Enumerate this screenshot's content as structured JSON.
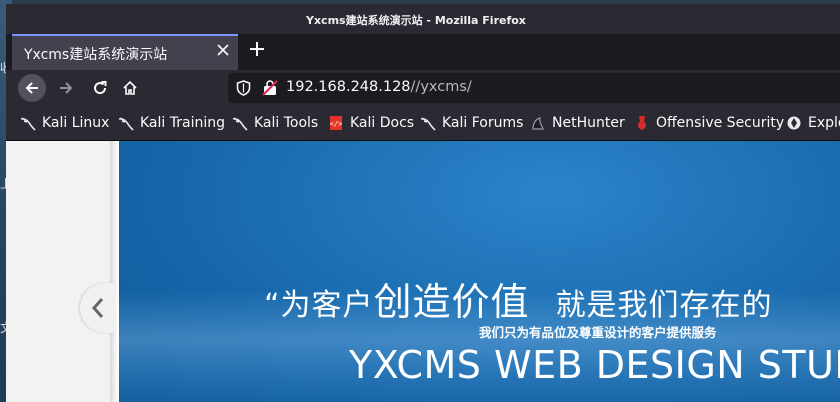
{
  "window": {
    "title": "Yxcms建站系统演示站 - Mozilla Firefox"
  },
  "desktop": {
    "fragments": [
      "收",
      "上",
      "文"
    ]
  },
  "tabs": [
    {
      "title": "Yxcms建站系统演示站",
      "close_icon": "close-icon"
    }
  ],
  "toolbar": {
    "new_tab_icon": "plus-icon",
    "back_icon": "arrow-left-icon",
    "forward_icon": "arrow-right-icon",
    "reload_icon": "reload-icon",
    "home_icon": "home-icon"
  },
  "urlbar": {
    "host": "192.168.248.128",
    "path": "//yxcms/",
    "shield_icon": "shield-icon",
    "insecure_icon": "insecure-lock-icon"
  },
  "bookmarks": [
    {
      "label": "Kali Linux",
      "icon": "kali-dragon-icon"
    },
    {
      "label": "Kali Training",
      "icon": "kali-dragon-icon"
    },
    {
      "label": "Kali Tools",
      "icon": "kali-dragon-icon"
    },
    {
      "label": "Kali Docs",
      "icon": "kali-docs-icon"
    },
    {
      "label": "Kali Forums",
      "icon": "kali-dragon-icon"
    },
    {
      "label": "NetHunter",
      "icon": "nethunter-icon"
    },
    {
      "label": "Offensive Security",
      "icon": "offsec-icon"
    },
    {
      "label": "Explo",
      "icon": "exploit-db-icon"
    }
  ],
  "page": {
    "slogan_open": "“为客户",
    "slogan_mid": "创造价值",
    "slogan_tail": "就是我们存在的",
    "subtitle": "我们只为有品位及尊重设计的客户提供服务",
    "studio": "YXCMS WEB DESIGN STUDI",
    "prev_icon": "chevron-left-icon"
  },
  "colors": {
    "accent_tab": "#7b95ff",
    "banner_blue": "#1f73b7",
    "chrome_dark": "#2b2a33"
  }
}
